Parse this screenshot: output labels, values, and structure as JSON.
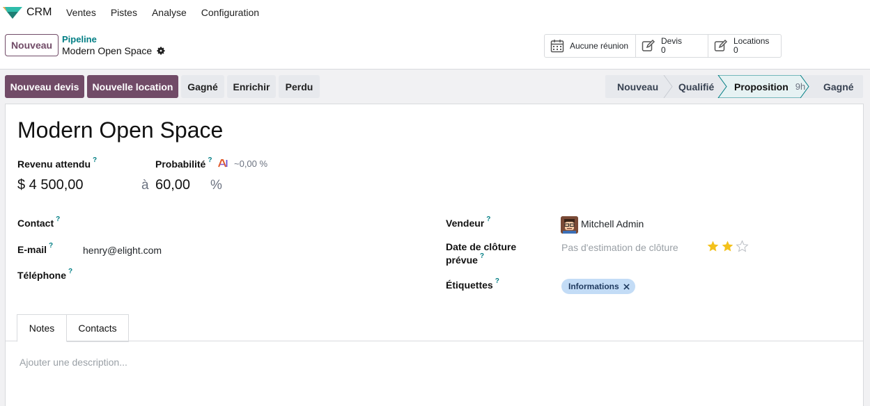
{
  "navbar": {
    "app_name": "CRM",
    "menu": [
      "Ventes",
      "Pistes",
      "Analyse",
      "Configuration"
    ]
  },
  "control_panel": {
    "new_button": "Nouveau",
    "breadcrumb_parent": "Pipeline",
    "breadcrumb_current": "Modern Open Space",
    "smart_buttons": [
      {
        "label": "Aucune réunion",
        "icon": "calendar-icon"
      },
      {
        "label": "Devis",
        "value": "0",
        "icon": "edit-icon"
      },
      {
        "label": "Locations",
        "value": "0",
        "icon": "edit-icon"
      }
    ]
  },
  "actions": {
    "new_quote": "Nouveau devis",
    "new_rental": "Nouvelle location",
    "won": "Gagné",
    "enrich": "Enrichir",
    "lost": "Perdu"
  },
  "stages": [
    {
      "label": "Nouveau"
    },
    {
      "label": "Qualifié"
    },
    {
      "label": "Proposition",
      "hours": "9h",
      "active": true
    },
    {
      "label": "Gagné"
    }
  ],
  "form": {
    "title": "Modern Open Space",
    "expected_revenue_label": "Revenu attendu",
    "expected_revenue": "$ 4 500,00",
    "at": "à",
    "probability_label": "Probabilité",
    "ai_probability": "~0,00 %",
    "probability": "60,00",
    "percent": "%",
    "contact_label": "Contact",
    "email_label": "E-mail",
    "email": "henry@elight.com",
    "phone_label": "Téléphone",
    "salesperson_label": "Vendeur",
    "salesperson": "Mitchell Admin",
    "close_date_label_1": "Date de clôture",
    "close_date_label_2": "prévue",
    "close_date_placeholder": "Pas d'estimation de clôture",
    "priority_stars": 2,
    "priority_max": 3,
    "tags_label": "Étiquettes",
    "tag": "Informations",
    "help": "?"
  },
  "notebook": {
    "tabs": [
      "Notes",
      "Contacts"
    ],
    "description_placeholder": "Ajouter une description..."
  },
  "colors": {
    "primary": "#714b67",
    "accent": "#017e84",
    "star": "#f3c11b",
    "tag_bg": "#c3dcf6"
  }
}
